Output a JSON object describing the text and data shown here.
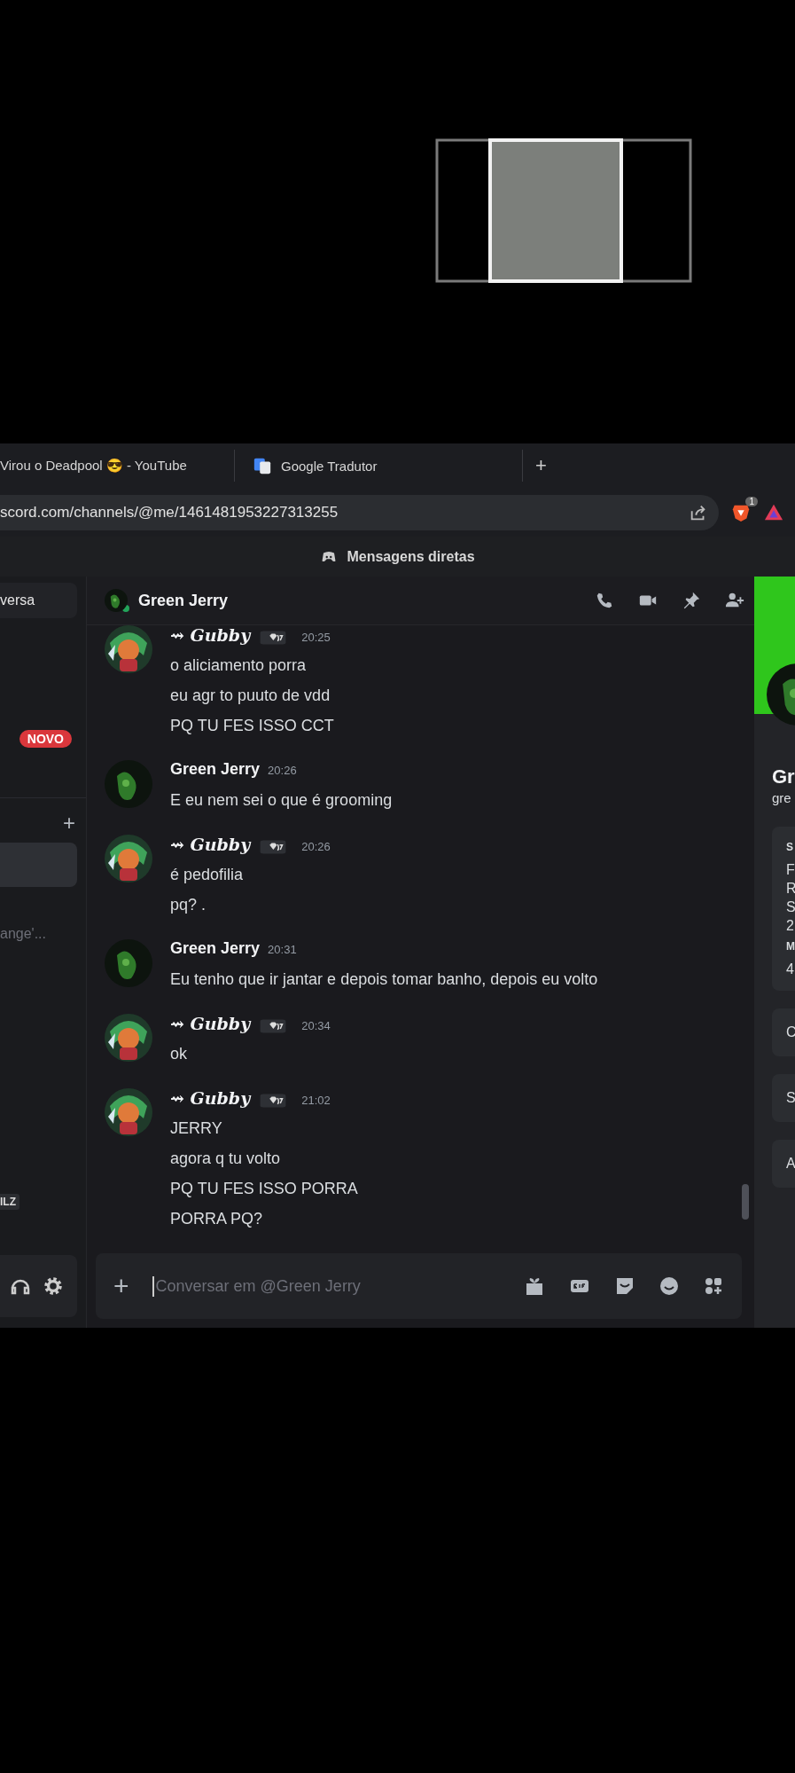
{
  "browser": {
    "tabs": [
      {
        "title": "Virou o Deadpool 😎 - YouTube",
        "kind": "page",
        "selected": false
      },
      {
        "title": "Google Tradutor",
        "kind": "translate",
        "selected": false
      }
    ],
    "new_tab": "+",
    "address": "scord.com/channels/@me/1461481953227313255",
    "shield_count": "1"
  },
  "banner": {
    "title": "Mensagens diretas"
  },
  "sidebar": {
    "start_button": "versa",
    "new_badge": "NOVO",
    "add": "+",
    "items": [
      {
        "selected": true
      },
      {
        "selected": false,
        "status": "ange'..."
      }
    ],
    "tag": "ILZ"
  },
  "channel": {
    "name": "Green Jerry",
    "online": true
  },
  "messages": [
    {
      "kind": "gubby",
      "author": "⇝ Gubby",
      "time": "20:25",
      "lines": [
        "o aliciamento porra",
        "eu agr to puuto de vdd",
        "PQ TU FES ISSO CCT"
      ]
    },
    {
      "kind": "jerry",
      "author": "Green Jerry",
      "time": "20:26",
      "lines": [
        "E eu nem sei o que é grooming"
      ]
    },
    {
      "kind": "gubby",
      "author": "⇝ Gubby",
      "time": "20:26",
      "lines": [
        "é pedofilia",
        "pq? ."
      ]
    },
    {
      "kind": "jerry",
      "author": "Green Jerry",
      "time": "20:31",
      "lines": [
        "Eu tenho que ir jantar e depois tomar banho, depois eu volto"
      ]
    },
    {
      "kind": "gubby",
      "author": "⇝ Gubby",
      "time": "20:34",
      "lines": [
        "ok"
      ]
    },
    {
      "kind": "gubby",
      "author": "⇝ Gubby",
      "time": "21:02",
      "lines": [
        "JERRY",
        "agora q tu volto",
        "PQ TU FES ISSO PORRA",
        "PORRA PQ?"
      ]
    }
  ],
  "composer": {
    "add": "+",
    "placeholder": "Conversar em @Green Jerry"
  },
  "profile": {
    "name": "Gr",
    "username": "gre",
    "card": [
      {
        "kind": "heading",
        "text": "S"
      },
      {
        "kind": "line",
        "text": "F"
      },
      {
        "kind": "line",
        "text": "R"
      },
      {
        "kind": "line",
        "text": "S"
      },
      {
        "kind": "line",
        "text": "2"
      },
      {
        "kind": "heading",
        "text": "M"
      },
      {
        "kind": "line",
        "text": "4"
      }
    ],
    "sections": [
      "C",
      "S",
      "A"
    ]
  }
}
